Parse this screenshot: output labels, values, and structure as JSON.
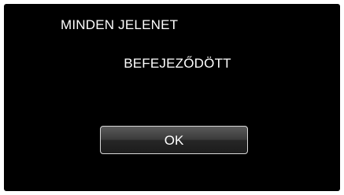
{
  "dialog": {
    "title": "MINDEN JELENET",
    "message": "BEFEJEZŐDÖTT",
    "ok_label": "OK"
  },
  "colors": {
    "background": "#000000",
    "text": "#ffffff",
    "button_border": "#d8d8d8"
  }
}
